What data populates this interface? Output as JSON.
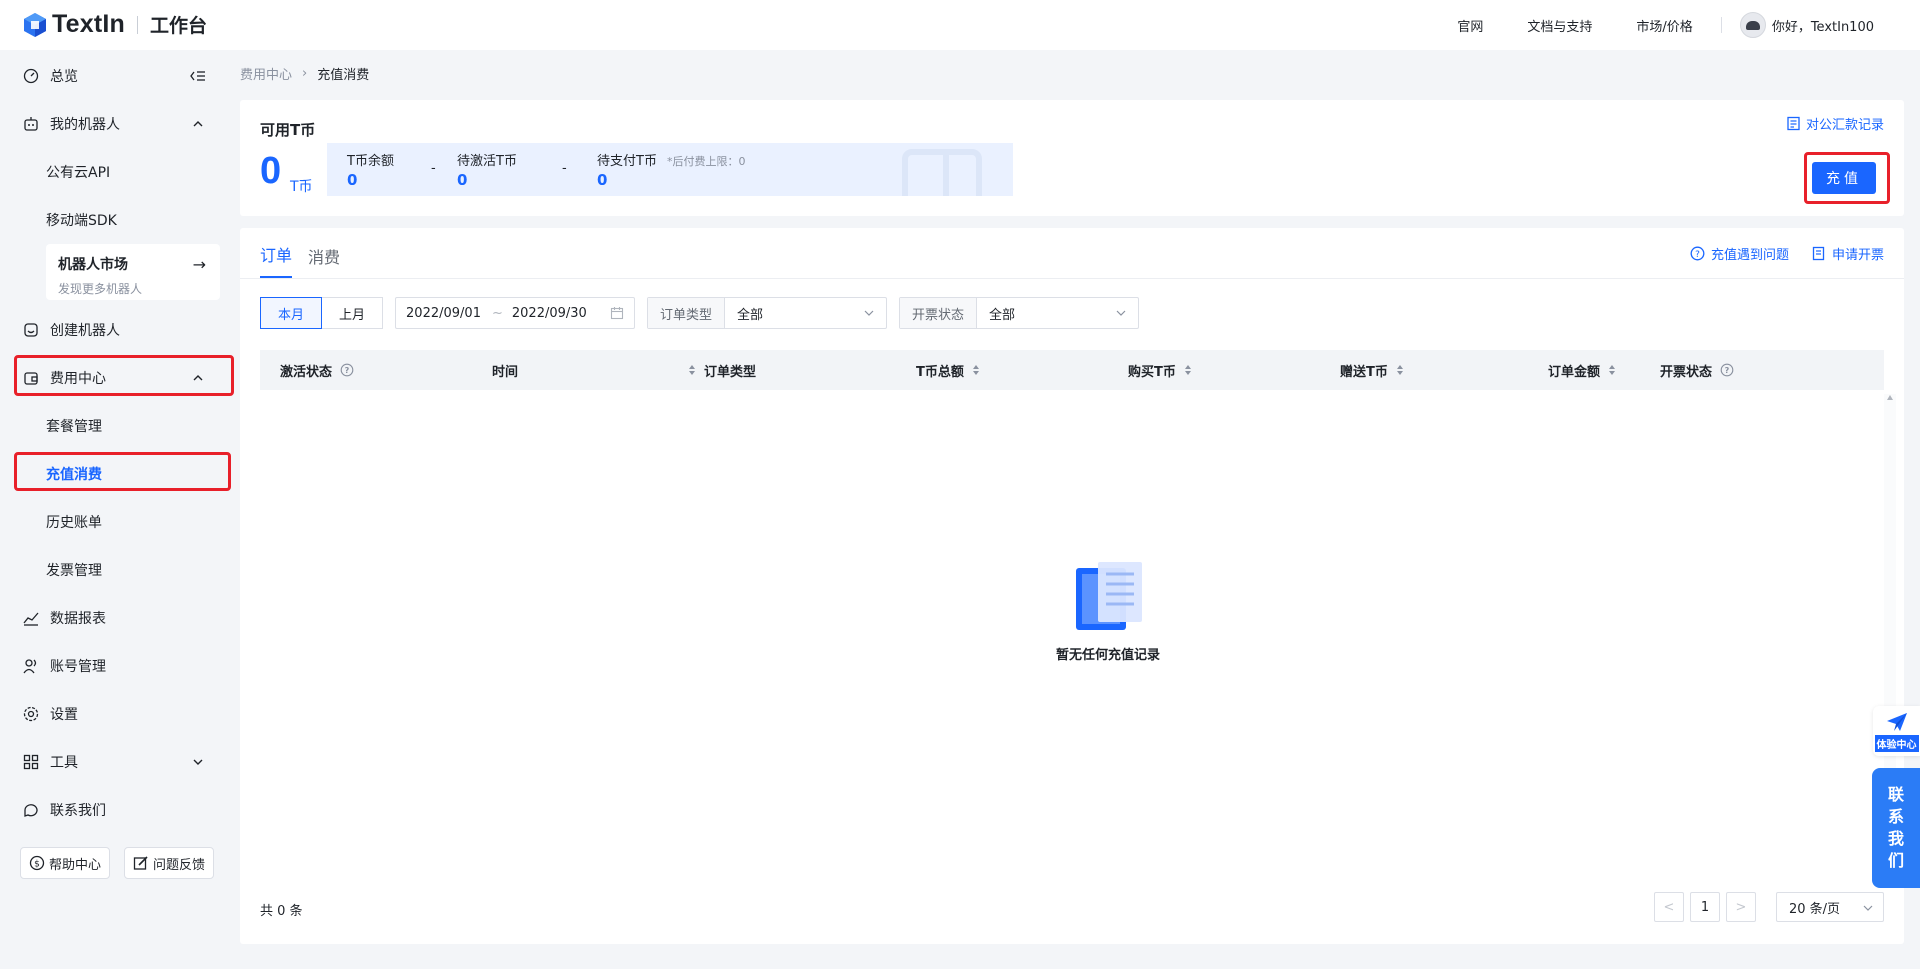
{
  "header": {
    "brand": "TextIn",
    "workspace": "工作台",
    "links": [
      "官网",
      "文档与支持",
      "市场/价格"
    ],
    "user_greeting": "你好，TextIn100"
  },
  "sidebar": {
    "overview": "总览",
    "my_robots": "我的机器人",
    "public_api": "公有云API",
    "mobile_sdk": "移动端SDK",
    "market_title": "机器人市场",
    "market_sub": "发现更多机器人",
    "create_robot": "创建机器人",
    "billing_center": "费用中心",
    "package_mgmt": "套餐管理",
    "recharge_consume": "充值消费",
    "history_bills": "历史账单",
    "invoice_mgmt": "发票管理",
    "data_reports": "数据报表",
    "account_mgmt": "账号管理",
    "settings": "设置",
    "tools": "工具",
    "contact_us": "联系我们",
    "help_center": "帮助中心",
    "feedback": "问题反馈"
  },
  "breadcrumb": {
    "parent": "费用中心",
    "current": "充值消费"
  },
  "coin": {
    "title": "可用T币",
    "amount": "0",
    "unit": "T币",
    "balance_label": "T币余额",
    "balance_value": "0",
    "pending_activation_label": "待激活T币",
    "pending_activation_value": "0",
    "pending_payment_label": "待支付T币",
    "pending_payment_value": "0",
    "postpaid_note": "*后付费上限：0",
    "minus": "-",
    "wire_records": "对公汇款记录",
    "recharge_button": "充值"
  },
  "orders": {
    "tabs": [
      "订单",
      "消费"
    ],
    "help_recharge": "充值遇到问题",
    "apply_invoice": "申请开票",
    "period_this_month": "本月",
    "period_last_month": "上月",
    "date_start": "2022/09/01",
    "date_tilde": "~",
    "date_end": "2022/09/30",
    "order_type_label": "订单类型",
    "order_type_value": "全部",
    "invoice_status_label": "开票状态",
    "invoice_status_value": "全部",
    "columns": [
      "激活状态",
      "时间",
      "订单类型",
      "T币总额",
      "购买T币",
      "赠送T币",
      "订单金额",
      "开票状态"
    ],
    "empty_text": "暂无任何充值记录",
    "total_text": "共 0 条",
    "prev": "<",
    "page": "1",
    "next": ">",
    "page_size": "20 条/页"
  },
  "floating": {
    "experience_center": "体验中心",
    "contact": [
      "联",
      "系",
      "我",
      "们"
    ]
  },
  "colors": {
    "primary": "#1a66ff",
    "highlight_border": "#e8202a"
  }
}
